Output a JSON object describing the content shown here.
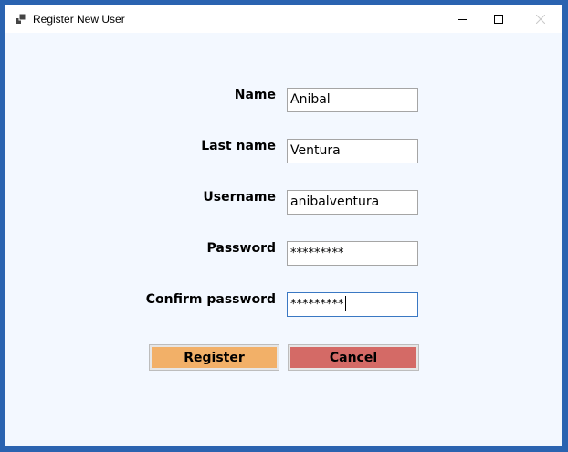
{
  "window": {
    "title": "Register New User",
    "icon": "app-window-icon",
    "controls": [
      "minimize-icon",
      "maximize-icon",
      "close-icon"
    ]
  },
  "form": {
    "name_label": "Name",
    "name_value": "Anibal",
    "lastname_label": "Last name",
    "lastname_value": "Ventura",
    "username_label": "Username",
    "username_value": "anibalventura",
    "password_label": "Password",
    "password_value": "*********",
    "confirm_label": "Confirm password",
    "confirm_value": "*********"
  },
  "buttons": {
    "register_label": "Register",
    "cancel_label": "Cancel"
  },
  "colors": {
    "frame": "#2a63b0",
    "client_background": "#f3f8ff",
    "register_button": "#f2b068",
    "cancel_button": "#d46a66",
    "focus_border": "#3a78c3"
  }
}
